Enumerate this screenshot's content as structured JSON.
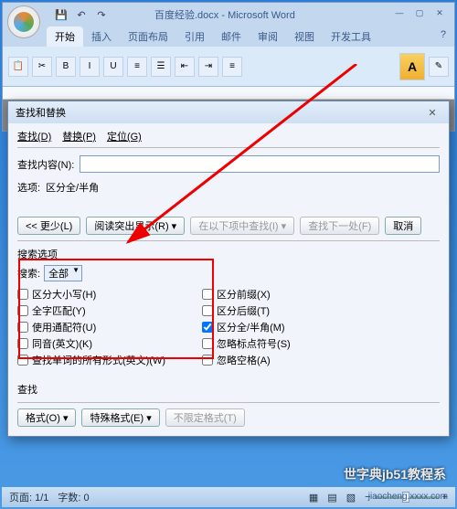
{
  "window": {
    "title": "百度经验.docx - Microsoft Word",
    "min": "—",
    "max": "▢",
    "close": "✕"
  },
  "ribbon": {
    "tabs": [
      "开始",
      "插入",
      "页面布局",
      "引用",
      "邮件",
      "审阅",
      "视图",
      "开发工具"
    ],
    "help_icon": "?",
    "style_btn": "A"
  },
  "dialog": {
    "title": "查找和替换",
    "tabs": {
      "find": "查找(D)",
      "replace": "替换(P)",
      "goto": "定位(G)"
    },
    "find_label": "查找内容(N):",
    "options_label": "选项:",
    "options_value": "区分全/半角",
    "buttons": {
      "less": "<< 更少(L)",
      "reading": "阅读突出显示(R) ▾",
      "findin": "在以下项中查找(I) ▾",
      "findnext": "查找下一处(F)",
      "cancel": "取消"
    },
    "search_options_label": "搜索选项",
    "search_dir_label": "搜索:",
    "search_dir_value": "全部",
    "checks_left": [
      {
        "label": "区分大小写(H)",
        "checked": false
      },
      {
        "label": "全字匹配(Y)",
        "checked": false
      },
      {
        "label": "使用通配符(U)",
        "checked": false
      },
      {
        "label": "同音(英文)(K)",
        "checked": false
      },
      {
        "label": "查找单词的所有形式(英文)(W)",
        "checked": false
      }
    ],
    "checks_right": [
      {
        "label": "区分前缀(X)",
        "checked": false
      },
      {
        "label": "区分后缀(T)",
        "checked": false
      },
      {
        "label": "区分全/半角(M)",
        "checked": true
      },
      {
        "label": "忽略标点符号(S)",
        "checked": false
      },
      {
        "label": "忽略空格(A)",
        "checked": false
      }
    ],
    "find_section": "查找",
    "format_btn": "格式(O) ▾",
    "special_btn": "特殊格式(E) ▾",
    "noformat_btn": "不限定格式(T)"
  },
  "statusbar": {
    "page": "页面: 1/1",
    "words": "字数: 0",
    "zoom_minus": "−",
    "zoom_plus": "+"
  },
  "watermark": "世字典jb51教程系",
  "url": "jiaocheng.xxxx.com"
}
